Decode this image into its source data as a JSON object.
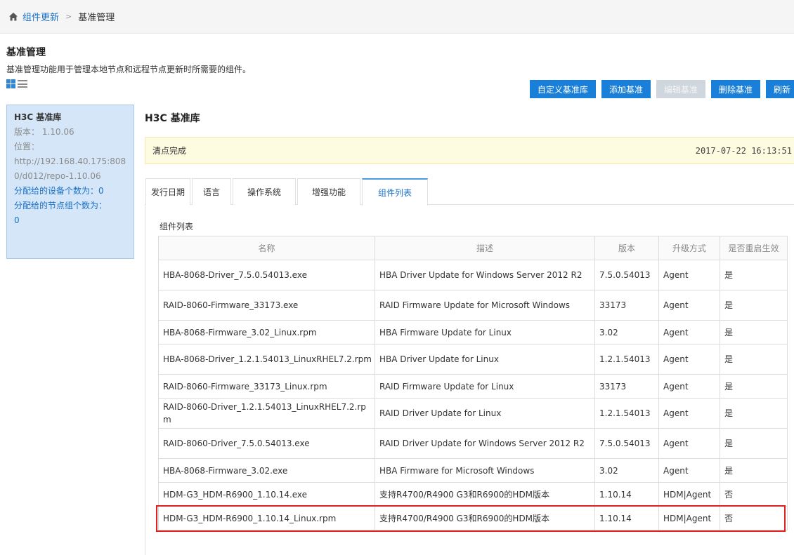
{
  "breadcrumb": {
    "home_icon": "home-icon",
    "parent": "组件更新",
    "separator": ">",
    "current": "基准管理"
  },
  "page": {
    "title": "基准管理",
    "description": "基准管理功能用于管理本地节点和远程节点更新时所需要的组件。"
  },
  "view_toggle": {
    "grid_icon": "grid-view-icon",
    "list_icon": "list-view-icon"
  },
  "toolbar": {
    "custom_repo": "自定义基准库",
    "add": "添加基准",
    "edit": "编辑基准",
    "delete": "删除基准",
    "refresh": "刷新"
  },
  "library_card": {
    "name": "H3C 基准库",
    "version": "版本： 1.10.06",
    "location_label": "位置：",
    "location_url": "http://192.168.40.175:8080/d012/repo-1.10.06",
    "devices": "分配给的设备个数为：0",
    "node_groups": "分配给的节点组个数为：",
    "node_groups_value": "0"
  },
  "content": {
    "title": "H3C 基准库",
    "status": "清点完成",
    "timestamp": "2017-07-22 16:13:51",
    "section_label": "组件列表"
  },
  "tabs": [
    "发行日期",
    "语言",
    "操作系统",
    "增强功能",
    "组件列表"
  ],
  "active_tab": "组件列表",
  "table": {
    "headers": [
      "名称",
      "描述",
      "版本",
      "升级方式",
      "是否重启生效"
    ],
    "rows": [
      [
        "HBA-8068-Driver_7.5.0.54013.exe",
        "HBA Driver Update for Windows Server 2012 R2",
        "7.5.0.54013",
        "Agent",
        "是"
      ],
      [
        "RAID-8060-Firmware_33173.exe",
        "RAID Firmware Update for Microsoft Windows",
        "33173",
        "Agent",
        "是"
      ],
      [
        "HBA-8068-Firmware_3.02_Linux.rpm",
        "HBA Firmware Update for Linux",
        "3.02",
        "Agent",
        "是"
      ],
      [
        "HBA-8068-Driver_1.2.1.54013_LinuxRHEL7.2.rpm",
        "HBA Driver Update for Linux",
        "1.2.1.54013",
        "Agent",
        "是"
      ],
      [
        "RAID-8060-Firmware_33173_Linux.rpm",
        "RAID Firmware Update for Linux",
        "33173",
        "Agent",
        "是"
      ],
      [
        "RAID-8060-Driver_1.2.1.54013_LinuxRHEL7.2.rpm",
        "RAID Driver Update for Linux",
        "1.2.1.54013",
        "Agent",
        "是"
      ],
      [
        "RAID-8060-Driver_7.5.0.54013.exe",
        "RAID Driver Update for Windows Server 2012 R2",
        "7.5.0.54013",
        "Agent",
        "是"
      ],
      [
        "HBA-8068-Firmware_3.02.exe",
        "HBA Firmware for Microsoft Windows",
        "3.02",
        "Agent",
        "是"
      ],
      [
        "HDM-G3_HDM-R6900_1.10.14.exe",
        "支持R4700/R4900 G3和R6900的HDM版本",
        "1.10.14",
        "HDM|Agent",
        "否"
      ],
      [
        "HDM-G3_HDM-R6900_1.10.14_Linux.rpm",
        "支持R4700/R4900 G3和R6900的HDM版本",
        "1.10.14",
        "HDM|Agent",
        "否"
      ]
    ],
    "highlighted_row": 8,
    "highlight_color": "#e02020"
  }
}
